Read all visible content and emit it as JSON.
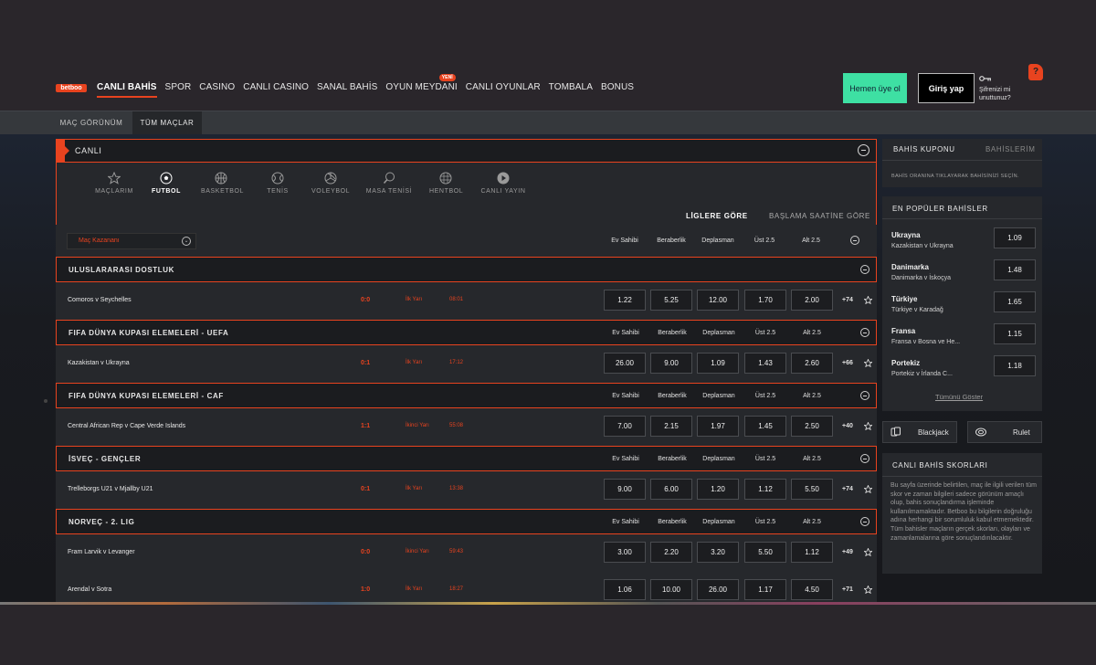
{
  "header": {
    "logo": "betboo",
    "nav": [
      {
        "label": "CANLI BAHİS",
        "active": true
      },
      {
        "label": "SPOR"
      },
      {
        "label": "CASINO"
      },
      {
        "label": "CANLI CASINO"
      },
      {
        "label": "SANAL BAHİS"
      },
      {
        "label": "OYUN MEYDANI",
        "badge": "YENİ"
      },
      {
        "label": "CANLI OYUNLAR"
      },
      {
        "label": "TOMBALA"
      },
      {
        "label": "BONUS"
      }
    ],
    "signup_label": "Hemen üye ol",
    "login_label": "Giriş yap",
    "forgot_label": "Şifrenizi mi unuttunuz?",
    "help_label": "?"
  },
  "subnav": {
    "match_view": "MAÇ GÖRÜNÜM",
    "all_matches": "TÜM MAÇLAR"
  },
  "live": {
    "title": "CANLI",
    "sports": [
      {
        "label": "MAÇLARIM",
        "icon": "star-icon"
      },
      {
        "label": "FUTBOL",
        "icon": "football-icon",
        "active": true
      },
      {
        "label": "BASKETBOL",
        "icon": "basketball-icon"
      },
      {
        "label": "TENİS",
        "icon": "tennis-icon"
      },
      {
        "label": "VOLEYBOL",
        "icon": "volleyball-icon"
      },
      {
        "label": "MASA TENİSİ",
        "icon": "table-tennis-icon"
      },
      {
        "label": "HENTBOL",
        "icon": "handball-icon"
      },
      {
        "label": "CANLI YAYIN",
        "icon": "play-icon"
      }
    ],
    "sort": {
      "by_league": "LİGLERE GÖRE",
      "by_start": "BAŞLAMA SAATİNE GÖRE"
    },
    "market_select": "Maç Kazananı",
    "columns": [
      "Ev Sahibi",
      "Beraberlik",
      "Deplasman",
      "Üst 2.5",
      "Alt 2.5"
    ],
    "leagues": [
      {
        "name": "ULUSLARARASI DOSTLUK",
        "show_columns": false,
        "matches": [
          {
            "name": "Comoros v Seychelles",
            "score": "0:0",
            "period": "İlk Yarı",
            "clock": "08:01",
            "odds": [
              "1.22",
              "5.25",
              "12.00",
              "1.70",
              "2.00"
            ],
            "more": "+74"
          }
        ]
      },
      {
        "name": "FIFA DÜNYA KUPASI ELEMELERİ - UEFA",
        "show_columns": true,
        "matches": [
          {
            "name": "Kazakistan v Ukrayna",
            "score": "0:1",
            "period": "İlk Yarı",
            "clock": "17:12",
            "odds": [
              "26.00",
              "9.00",
              "1.09",
              "1.43",
              "2.60"
            ],
            "more": "+66"
          }
        ]
      },
      {
        "name": "FIFA DÜNYA KUPASI ELEMELERİ - CAF",
        "show_columns": true,
        "matches": [
          {
            "name": "Central African Rep v Cape Verde Islands",
            "score": "1:1",
            "period": "İkinci Yarı",
            "clock": "55:08",
            "odds": [
              "7.00",
              "2.15",
              "1.97",
              "1.45",
              "2.50"
            ],
            "more": "+40"
          }
        ]
      },
      {
        "name": "İSVEÇ - GENÇLER",
        "show_columns": true,
        "matches": [
          {
            "name": "Trelleborgs U21 v Mjallby U21",
            "score": "0:1",
            "period": "İlk Yarı",
            "clock": "13:38",
            "odds": [
              "9.00",
              "6.00",
              "1.20",
              "1.12",
              "5.50"
            ],
            "more": "+74"
          }
        ]
      },
      {
        "name": "NORVEÇ - 2. LIG",
        "show_columns": true,
        "matches": [
          {
            "name": "Fram Larvik v Levanger",
            "score": "0:0",
            "period": "İkinci Yarı",
            "clock": "59:43",
            "odds": [
              "3.00",
              "2.20",
              "3.20",
              "5.50",
              "1.12"
            ],
            "more": "+49"
          },
          {
            "name": "Arendal v Sotra",
            "score": "1:0",
            "period": "İlk Yarı",
            "clock": "18:27",
            "odds": [
              "1.06",
              "10.00",
              "26.00",
              "1.17",
              "4.50"
            ],
            "more": "+71"
          }
        ]
      }
    ]
  },
  "coupon": {
    "tab_coupon": "BAHİS KUPONU",
    "tab_bets": "BAHİSLERİM",
    "hint": "BAHİS ORANINA TIKLAYARAK BAHİSİNİZİ SEÇİN."
  },
  "popular": {
    "title": "EN POPÜLER BAHİSLER",
    "items": [
      {
        "team": "Ukrayna",
        "match": "Kazakistan v Ukrayna",
        "odd": "1.09"
      },
      {
        "team": "Danimarka",
        "match": "Danimarka v İskoçya",
        "odd": "1.48"
      },
      {
        "team": "Türkiye",
        "match": "Türkiye v Karadağ",
        "odd": "1.65"
      },
      {
        "team": "Fransa",
        "match": "Fransa v Bosna ve He...",
        "odd": "1.15"
      },
      {
        "team": "Portekiz",
        "match": "Portekiz v İrlanda C...",
        "odd": "1.18"
      }
    ],
    "show_all": "Tümünü Göster"
  },
  "games": {
    "blackjack": "Blackjack",
    "roulette": "Rulet"
  },
  "scores": {
    "title": "CANLI BAHİS SKORLARI",
    "text": "Bu sayfa üzerinde belirtilen, maç ile ilgili verilen tüm skor ve zaman bilgileri sadece görünüm amaçlı olup, bahis sonuçlandırma işleminde kullanılmamaktadır. Betboo bu bilgilerin doğruluğu adına herhangi bir sorumluluk kabul etmemektedir. Tüm bahisler maçların gerçek skorları, olayları ve zamanlamalarına göre sonuçlandırılacaktır."
  },
  "colors": {
    "accent": "#e8431f",
    "signup": "#3ee0a3",
    "panel": "#26282c",
    "header_row": "#1b1c1f"
  }
}
